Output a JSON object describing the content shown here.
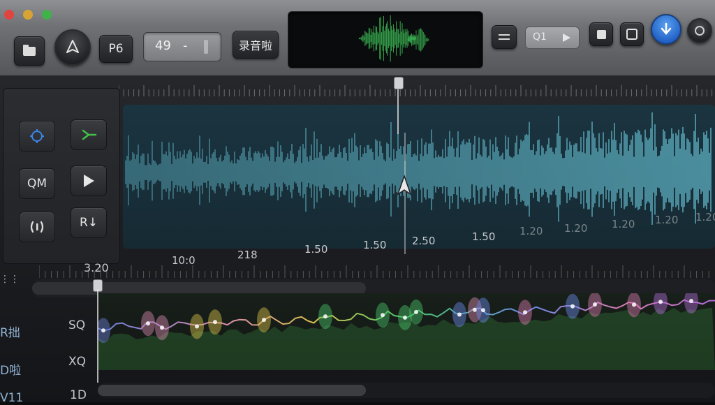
{
  "toolbar": {
    "record_count_label": "P6",
    "value_field": "49",
    "value_separator": "-",
    "record_button_label": "录音啦",
    "mini_display": "Q1"
  },
  "side_panel": {
    "qm_label": "QM",
    "r_label": "R↓"
  },
  "ruler_top_labels": [
    "10:0",
    "218",
    "1.50",
    "1.50",
    "2.50",
    "1.50",
    "1.20",
    "1.20",
    "1.20",
    "1.20",
    "1.20"
  ],
  "lower_ruler_start": "3.20",
  "tracks": [
    {
      "left_label": "R拙",
      "right_label": "SQ"
    },
    {
      "left_label": "D啦",
      "right_label": "XQ"
    },
    {
      "left_label": "V11",
      "right_label": "1D"
    }
  ],
  "colors": {
    "waveform": "#5fb3c4",
    "scope_wave": "#3fc45a",
    "accent_blue": "#2f7fe0",
    "accent_green": "#43c04a"
  }
}
